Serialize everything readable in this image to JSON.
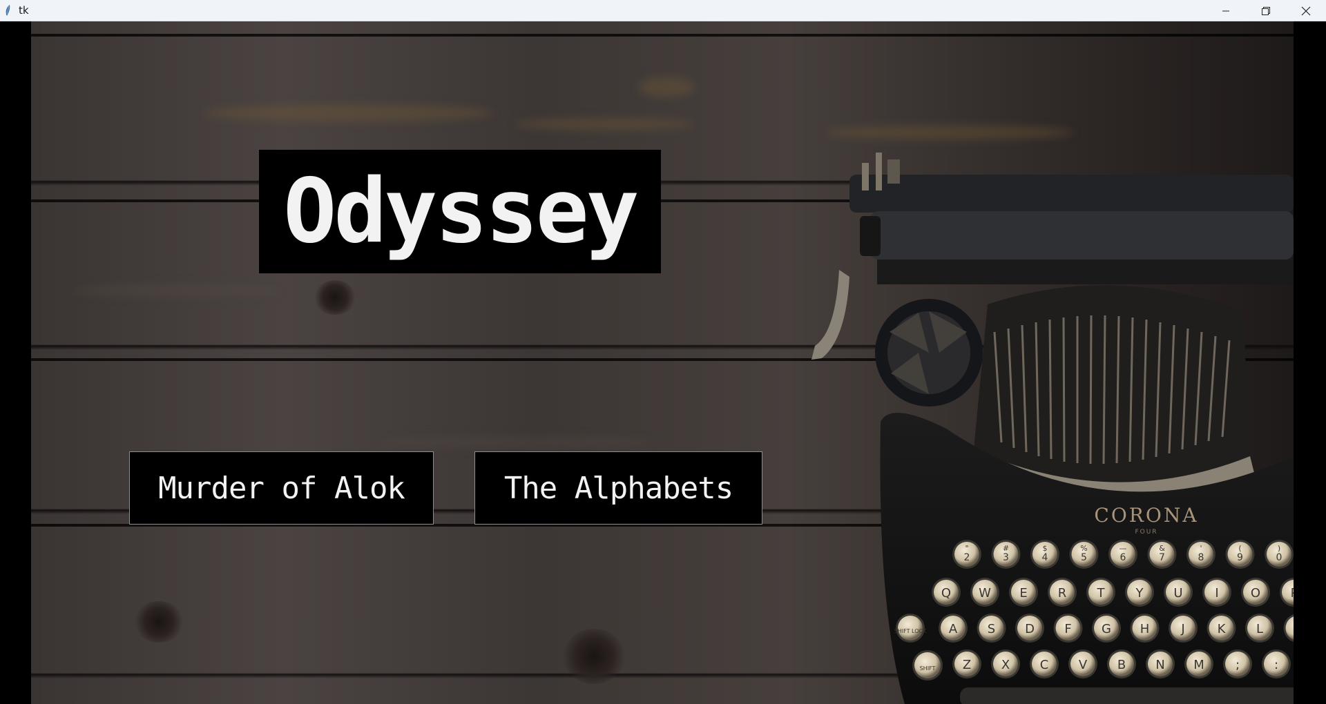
{
  "window": {
    "title": "tk",
    "controls": {
      "minimize_icon": "minimize-icon",
      "maximize_icon": "restore-icon",
      "close_icon": "close-icon"
    }
  },
  "main": {
    "title": "Odyssey",
    "buttons": [
      {
        "label": "Murder of Alok"
      },
      {
        "label": "The Alphabets"
      }
    ]
  },
  "typewriter": {
    "brand": "CORONA",
    "model": "FOUR",
    "number_row": [
      "2",
      "3",
      "4",
      "5",
      "6",
      "7",
      "8",
      "9",
      "0"
    ],
    "number_shift": [
      "\"",
      "#",
      "$",
      "%",
      "—",
      "&",
      "'",
      "(",
      ")"
    ],
    "row1": [
      "Q",
      "W",
      "E",
      "R",
      "T",
      "Y",
      "U",
      "I",
      "O",
      "P"
    ],
    "row2": [
      "A",
      "S",
      "D",
      "F",
      "G",
      "H",
      "J",
      "K",
      "L",
      ";"
    ],
    "row3": [
      "Z",
      "X",
      "C",
      "V",
      "B",
      "N",
      "M",
      ";",
      ":",
      "?"
    ],
    "shift_lock": "SHIFT LOCK",
    "shift": "SHIFT"
  },
  "colors": {
    "titlebar_bg": "#f0f4f9",
    "button_bg": "#000000",
    "button_text": "#f2f2f2",
    "wood_dark": "#302a28",
    "wood_light": "#4a4341"
  }
}
